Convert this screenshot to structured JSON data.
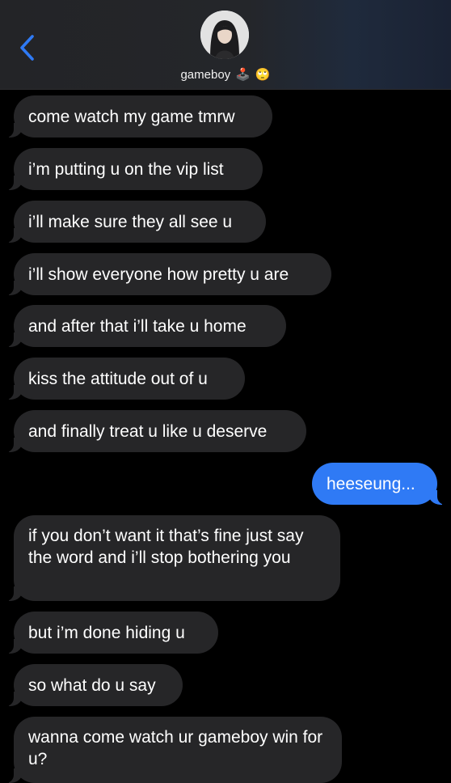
{
  "header": {
    "contact_name": "gameboy",
    "emoji_1": "🕹️",
    "emoji_2": "🙄"
  },
  "messages": [
    {
      "from": "them",
      "text": "come watch my game tmrw"
    },
    {
      "from": "them",
      "text": "i’m putting u on the vip list"
    },
    {
      "from": "them",
      "text": "i’ll make sure they all see u"
    },
    {
      "from": "them",
      "text": "i’ll show everyone how pretty u are"
    },
    {
      "from": "them",
      "text": "and after that i’ll take u home"
    },
    {
      "from": "them",
      "text": "kiss the attitude out of u"
    },
    {
      "from": "them",
      "text": "and finally treat u like u deserve"
    },
    {
      "from": "me",
      "text": "heeseung..."
    },
    {
      "from": "them",
      "text": "if you don’t want it that’s fine just say the word and i’ll stop bothering you"
    },
    {
      "from": "them",
      "text": "but i’m done hiding u"
    },
    {
      "from": "them",
      "text": "so what do u say"
    },
    {
      "from": "them",
      "text": "wanna come watch ur gameboy win for u?"
    }
  ],
  "colors": {
    "incoming_bubble": "#262628",
    "outgoing_bubble": "#2f7af5",
    "back_chevron": "#2f7af5"
  }
}
